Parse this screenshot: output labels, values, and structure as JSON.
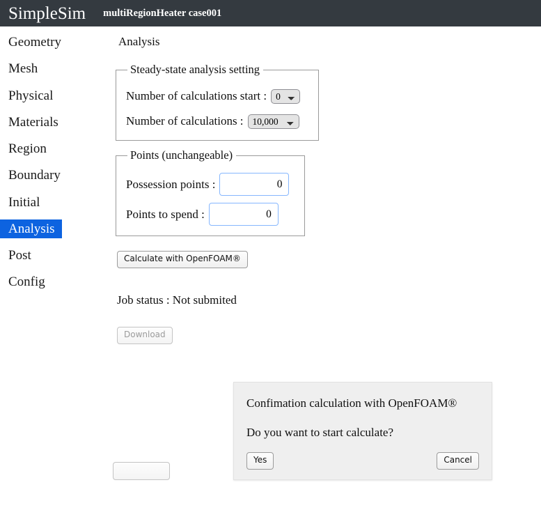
{
  "header": {
    "brand": "SimpleSim",
    "case_title": "multiRegionHeater case001",
    "background_color": "#343a40"
  },
  "sidebar": {
    "active_index": 7,
    "active_color": "#0d63e0",
    "items": [
      {
        "label": "Geometry"
      },
      {
        "label": "Mesh"
      },
      {
        "label": "Physical"
      },
      {
        "label": "Materials"
      },
      {
        "label": "Region"
      },
      {
        "label": "Boundary"
      },
      {
        "label": "Initial"
      },
      {
        "label": "Analysis"
      },
      {
        "label": "Post"
      },
      {
        "label": "Config"
      }
    ]
  },
  "main": {
    "page_title": "Analysis",
    "steady_panel": {
      "legend": "Steady-state analysis setting",
      "calc_start_label": "Number of calculations start :",
      "calc_start_value": "0",
      "calc_start_options": [
        "0"
      ],
      "calc_count_label": "Number of calculations :",
      "calc_count_value": "10,000",
      "calc_count_options": [
        "10,000"
      ]
    },
    "points_panel": {
      "legend": "Points (unchangeable)",
      "possession_label": "Possession points :",
      "possession_value": "0",
      "spend_label": "Points to spend :",
      "spend_value": "0"
    },
    "calculate_button": "Calculate with OpenFOAM®",
    "job_status": "Job status : Not submited",
    "download_button": "Download"
  },
  "modal": {
    "title": "Confimation calculation with OpenFOAM®",
    "question": "Do you want to start calculate?",
    "yes_label": "Yes",
    "cancel_label": "Cancel",
    "background_color": "#efefef"
  }
}
